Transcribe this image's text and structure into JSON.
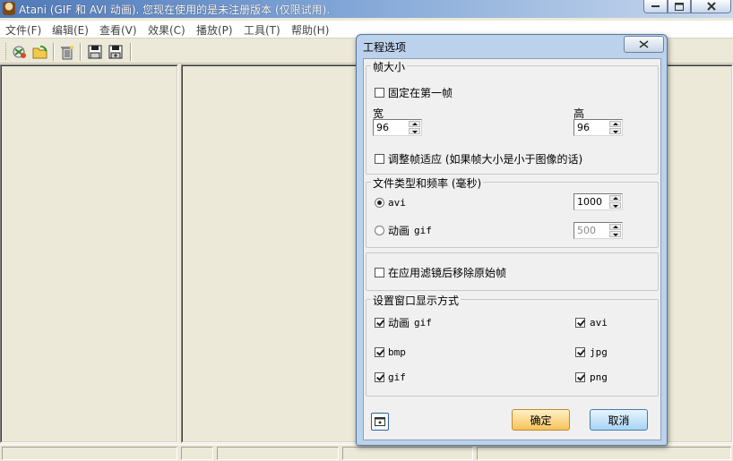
{
  "window": {
    "title": "Atani (GIF 和 AVI 动画). 您现在使用的是未注册版本 (仅限试用)."
  },
  "menu": {
    "items": [
      "文件(F)",
      "编辑(E)",
      "查看(V)",
      "效果(C)",
      "播放(P)",
      "工具(T)",
      "帮助(H)"
    ]
  },
  "toolbar": {
    "buttons": [
      "open-icon",
      "new-icon",
      "delete-icon",
      "save-icon",
      "save-as-icon"
    ]
  },
  "dialog": {
    "title": "工程选项",
    "frame_size": {
      "legend": "帧大小",
      "fix_first_label": "固定在第一帧",
      "fix_first_checked": false,
      "width_label": "宽",
      "width_value": "96",
      "height_label": "高",
      "height_value": "96",
      "adjust_label": "调整帧适应 (如果帧大小是小于图像的话)",
      "adjust_checked": false
    },
    "file_type": {
      "legend": "文件类型和频率 (毫秒)",
      "avi_label": "avi",
      "avi_selected": true,
      "avi_value": "1000",
      "gif_label_cn": "动画",
      "gif_label": "gif",
      "gif_selected": false,
      "gif_value": "500"
    },
    "filter": {
      "remove_original_label": "在应用滤镜后移除原始帧",
      "remove_original_checked": false
    },
    "display": {
      "legend": "设置窗口显示方式",
      "anim_gif_cn": "动画",
      "anim_gif": "gif",
      "avi": "avi",
      "bmp": "bmp",
      "jpg": "jpg",
      "gif": "gif",
      "png": "png",
      "checked": [
        true,
        true,
        true,
        true,
        true,
        true
      ]
    },
    "ok_label": "确定",
    "cancel_label": "取消"
  },
  "colors": {
    "title_gradient_start": "#4f79b8",
    "dialog_frame": "#bcd2ec",
    "ok_button": "#f6c25a",
    "cancel_button": "#a9d3f3"
  }
}
